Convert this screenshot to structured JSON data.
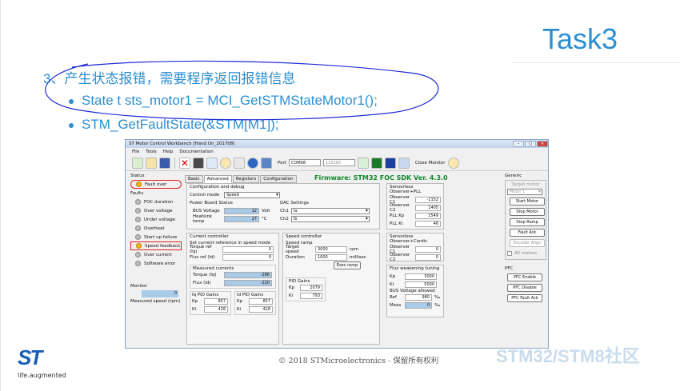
{
  "slide": {
    "title": "Task3",
    "bullet1": "3、产生状态报错，需要程序返回报错信息",
    "bullet2": "State t sts_motor1 = MCI_GetSTMStateMotor1();",
    "bullet3": "STM_GetFaultState(&STM[M1]);",
    "copyright": "© 2018 STMicroelectronics - 保留所有权利",
    "logo_tagline": "life.augmented",
    "watermark": "STM32/STM8社区"
  },
  "app": {
    "window_title": "ST Motor Control Workbench [Hand On_201708]",
    "menu": [
      "File",
      "Tools",
      "Help",
      "Documentation"
    ],
    "port_label": "Port",
    "port_value": "COM08",
    "baud_value": "115200",
    "close_monitor": "Close Monitor",
    "status": {
      "header": "Status",
      "fault_over": "Fault over",
      "faults_header": "Faults",
      "items": [
        "FOC duration",
        "Over voltage",
        "Under voltage",
        "Overheat",
        "Start up failure",
        "Speed feedback",
        "Over current",
        "Software error"
      ]
    },
    "monitor": {
      "header": "Monitor",
      "value": "0",
      "label": "Measured speed (rpm)"
    },
    "tabs": [
      "Basic",
      "Advanced",
      "Registers",
      "Configuration"
    ],
    "firmware": "Firmware: STM32 FOC SDK Ver. 4.3.0",
    "config": {
      "title": "Configuration and debug",
      "control_mode_label": "Control mode",
      "control_mode_value": "Speed",
      "power_board_title": "Power Board Status",
      "bus_voltage_label": "BUS Voltage",
      "bus_voltage_value": "12",
      "bus_voltage_unit": "Volt",
      "heatsink_label": "Heatsink temp",
      "heatsink_value": "27",
      "heatsink_unit": "°C",
      "dac_title": "DAC Settings",
      "ch1_label": "Ch1",
      "ch1_value": "Ia",
      "ch2_label": "Ch2",
      "ch2_value": "Ib"
    },
    "current_controller": {
      "title": "Current controller",
      "sub": "Set current reference in speed mode",
      "torque_label": "Torque ref (Iq)",
      "torque_value": "0",
      "flux_label": "Flux ref (Id)",
      "flux_value": "0",
      "measured_title": "Measured currents",
      "torque_meas_label": "Torque (Iq)",
      "torque_meas_value": "-286",
      "flux_meas_label": "Flux (Id)",
      "flux_meas_value": "-220",
      "iq_pid_title": "Iq PID Gains",
      "iq_kp": "857",
      "iq_ki": "428",
      "id_pid_title": "Id PID Gains",
      "id_kp": "857",
      "id_ki": "428",
      "kp_label": "Kp",
      "ki_label": "Ki"
    },
    "speed_controller": {
      "title": "Speed controller",
      "ramp_title": "Speed ramp",
      "target_label": "Target speed",
      "target_value": "3000",
      "target_unit": "rpm",
      "duration_label": "Duration",
      "duration_value": "1000",
      "duration_unit": "millisec",
      "exec_ramp": "Exec ramp",
      "pid_title": "PID Gains",
      "kp": "2079",
      "ki": "793"
    },
    "sensorless_pll": {
      "title": "Sensorless Observer+PLL",
      "c1_label": "Observer C1",
      "c1_value": "-1152",
      "c2_label": "Observer C2",
      "c2_value": "1405",
      "kp_label": "PLL Kp",
      "kp_value": "1549",
      "ki_label": "PLL Ki",
      "ki_value": "46"
    },
    "sensorless_cordic": {
      "title": "Sensorless Observer+Cordic",
      "c1_label": "Observer C1",
      "c1_value": "0",
      "c2_label": "Observer C2",
      "c2_value": "0"
    },
    "flux_weakening": {
      "title": "Flux weakening tuning",
      "kp_value": "3000",
      "ki_value": "5000",
      "bus_allowed": "BUS Voltage allowed",
      "ref_label": "Ref",
      "ref_value": "980",
      "ref_unit": "‰",
      "meas_label": "Meas",
      "meas_value": "0",
      "meas_unit": "‰"
    },
    "generic": {
      "header": "Generic",
      "target_motor": "Target motor",
      "motor_value": "Motor 1",
      "buttons": [
        "Start Motor",
        "Stop Motor",
        "Stop Ramp",
        "Fault Ack",
        "Encoder Align"
      ],
      "all_motors": "All motors",
      "pfc_header": "PFC",
      "pfc_buttons": [
        "PFC Enable",
        "PFC Disable",
        "PFC Fault Ack"
      ]
    }
  }
}
